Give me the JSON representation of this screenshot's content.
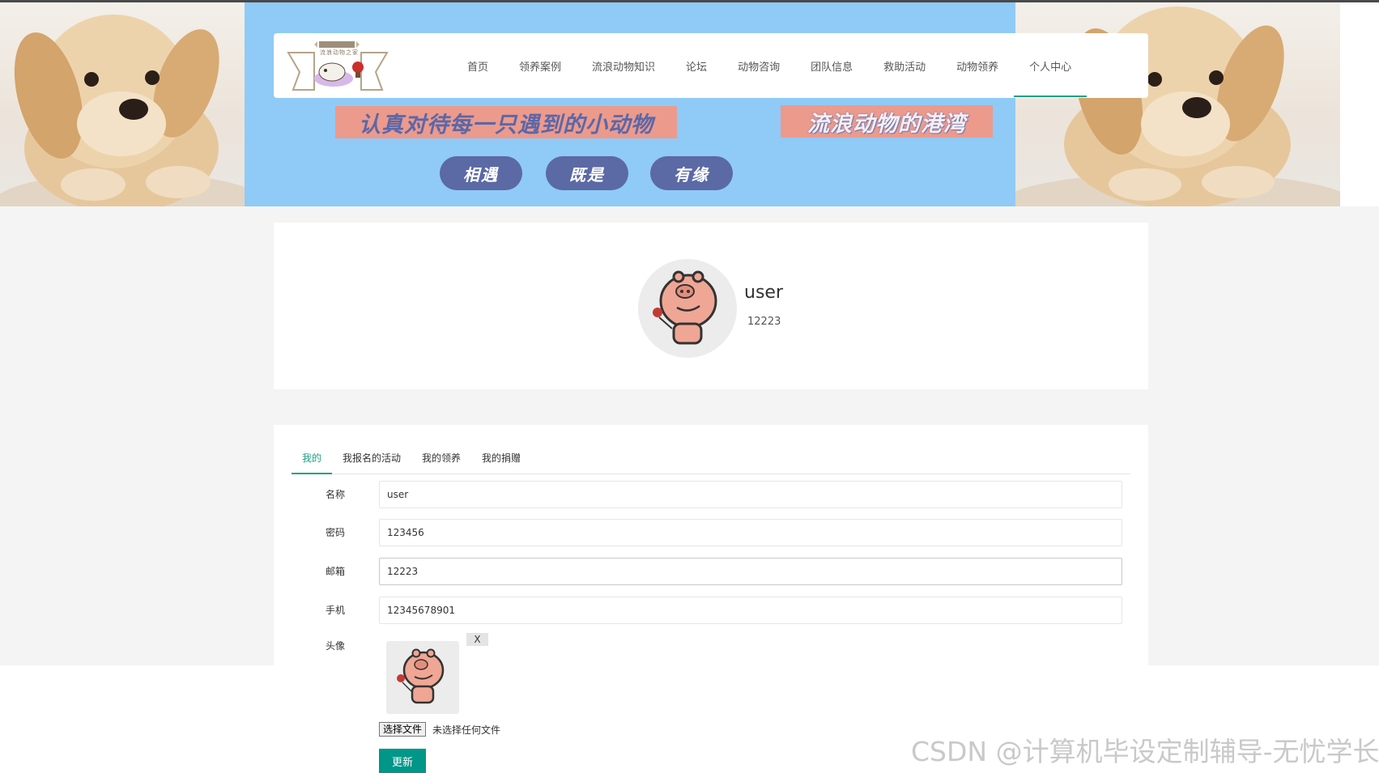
{
  "logo": {
    "text": "流浪动物之家"
  },
  "nav": {
    "items": [
      {
        "label": "首页"
      },
      {
        "label": "领养案例"
      },
      {
        "label": "流浪动物知识"
      },
      {
        "label": "论坛"
      },
      {
        "label": "动物咨询"
      },
      {
        "label": "团队信息"
      },
      {
        "label": "救助活动"
      },
      {
        "label": "动物领养"
      },
      {
        "label": "个人中心"
      }
    ],
    "active_index": 8
  },
  "banner": {
    "slogan_left": "认真对待每一只遇到的小动物",
    "slogan_right": "流浪动物的港湾",
    "pills": [
      "相遇",
      "既是",
      "有缘"
    ]
  },
  "profile": {
    "name": "user",
    "email": "12223"
  },
  "tabs": [
    {
      "label": "我的"
    },
    {
      "label": "我报名的活动"
    },
    {
      "label": "我的领养"
    },
    {
      "label": "我的捐赠"
    }
  ],
  "form": {
    "name_label": "名称",
    "name_value": "user",
    "password_label": "密码",
    "password_value": "123456",
    "email_label": "邮箱",
    "email_value": "12223",
    "phone_label": "手机",
    "phone_value": "12345678901",
    "avatar_label": "头像",
    "remove_label": "X",
    "file_button": "选择文件",
    "file_status": "未选择任何文件",
    "submit_label": "更新"
  },
  "watermark": "CSDN @计算机毕设定制辅导-无忧学长",
  "colors": {
    "accent": "#009688",
    "banner_blue": "#90caf7",
    "pill": "#5b69a5",
    "slogan_bg": "#ec9a8c"
  }
}
